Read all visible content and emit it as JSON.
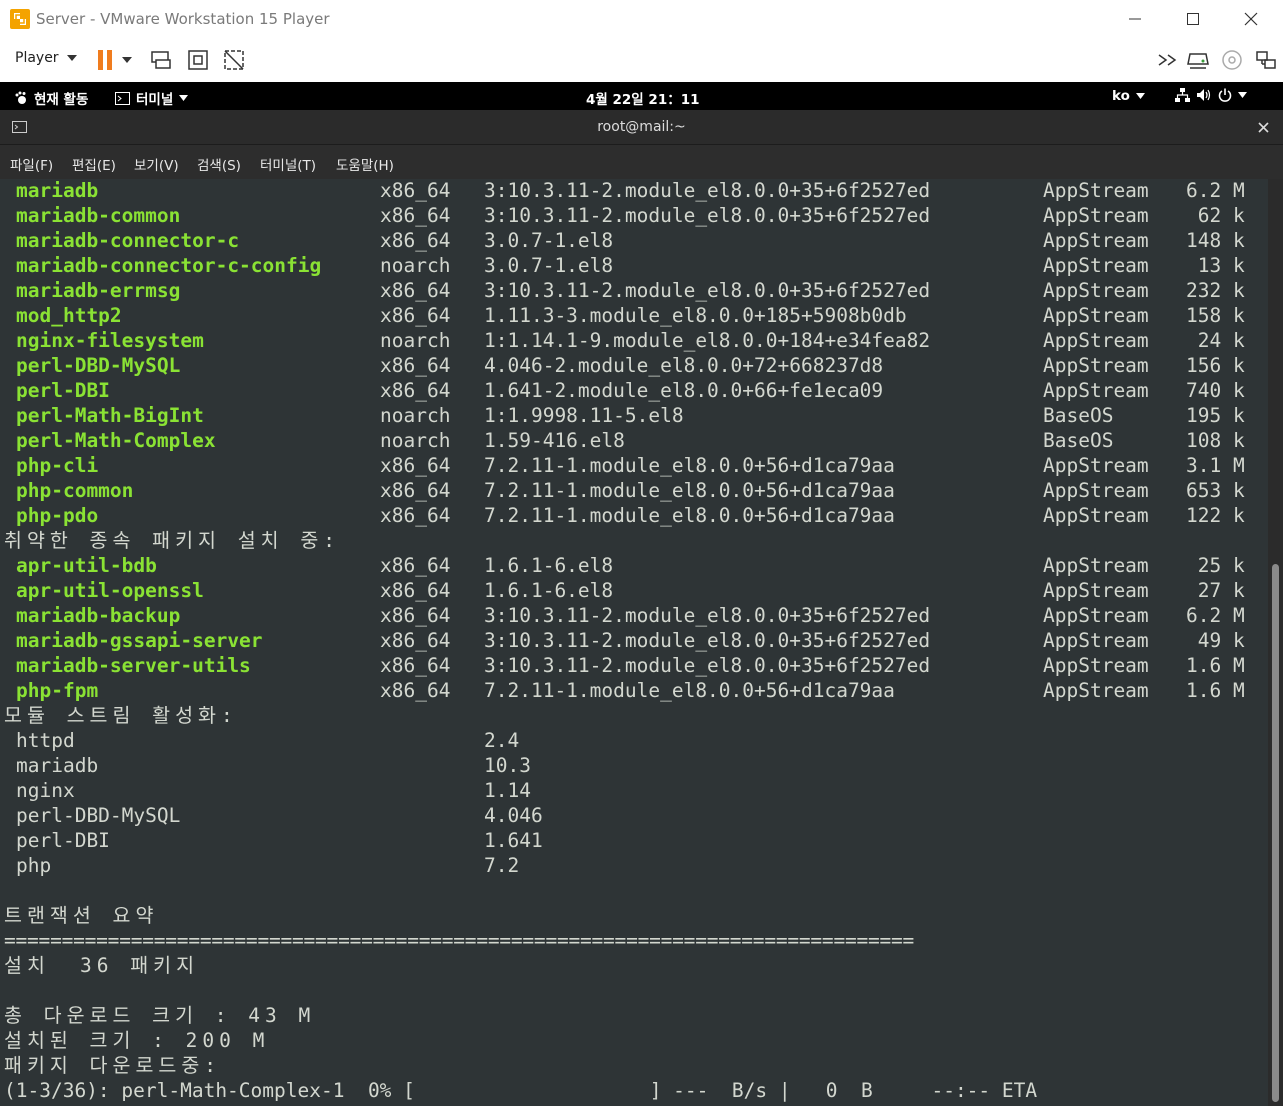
{
  "window": {
    "title": "Server - VMware Workstation 15 Player",
    "minimize_icon": "minimize-icon",
    "maximize_icon": "maximize-icon",
    "close_icon": "close-icon"
  },
  "toolbar": {
    "player_label": "Player"
  },
  "gnome_bar": {
    "activities": "현재 활동",
    "app_menu": "터미널",
    "clock": "4월 22일  21：11",
    "input_lang": "ko"
  },
  "terminal": {
    "title": "root@mail:~",
    "menu": [
      "파일(F)",
      "편집(E)",
      "보기(V)",
      "검색(S)",
      "터미널(T)",
      "도움말(H)"
    ],
    "packages": [
      {
        "name": "mariadb",
        "arch": "x86_64",
        "version": "3:10.3.11-2.module_el8.0.0+35+6f2527ed",
        "repo": "AppStream",
        "size": "6.2 M"
      },
      {
        "name": "mariadb-common",
        "arch": "x86_64",
        "version": "3:10.3.11-2.module_el8.0.0+35+6f2527ed",
        "repo": "AppStream",
        "size": " 62 k"
      },
      {
        "name": "mariadb-connector-c",
        "arch": "x86_64",
        "version": "3.0.7-1.el8",
        "repo": "AppStream",
        "size": "148 k"
      },
      {
        "name": "mariadb-connector-c-config",
        "arch": "noarch",
        "version": "3.0.7-1.el8",
        "repo": "AppStream",
        "size": " 13 k"
      },
      {
        "name": "mariadb-errmsg",
        "arch": "x86_64",
        "version": "3:10.3.11-2.module_el8.0.0+35+6f2527ed",
        "repo": "AppStream",
        "size": "232 k"
      },
      {
        "name": "mod_http2",
        "arch": "x86_64",
        "version": "1.11.3-3.module_el8.0.0+185+5908b0db",
        "repo": "AppStream",
        "size": "158 k"
      },
      {
        "name": "nginx-filesystem",
        "arch": "noarch",
        "version": "1:1.14.1-9.module_el8.0.0+184+e34fea82",
        "repo": "AppStream",
        "size": " 24 k"
      },
      {
        "name": "perl-DBD-MySQL",
        "arch": "x86_64",
        "version": "4.046-2.module_el8.0.0+72+668237d8",
        "repo": "AppStream",
        "size": "156 k"
      },
      {
        "name": "perl-DBI",
        "arch": "x86_64",
        "version": "1.641-2.module_el8.0.0+66+fe1eca09",
        "repo": "AppStream",
        "size": "740 k"
      },
      {
        "name": "perl-Math-BigInt",
        "arch": "noarch",
        "version": "1:1.9998.11-5.el8",
        "repo": "BaseOS",
        "size": "195 k"
      },
      {
        "name": "perl-Math-Complex",
        "arch": "noarch",
        "version": "1.59-416.el8",
        "repo": "BaseOS",
        "size": "108 k"
      },
      {
        "name": "php-cli",
        "arch": "x86_64",
        "version": "7.2.11-1.module_el8.0.0+56+d1ca79aa",
        "repo": "AppStream",
        "size": "3.1 M"
      },
      {
        "name": "php-common",
        "arch": "x86_64",
        "version": "7.2.11-1.module_el8.0.0+56+d1ca79aa",
        "repo": "AppStream",
        "size": "653 k"
      },
      {
        "name": "php-pdo",
        "arch": "x86_64",
        "version": "7.2.11-1.module_el8.0.0+56+d1ca79aa",
        "repo": "AppStream",
        "size": "122 k"
      }
    ],
    "weak_deps_header": "취약한 종속 패키지 설치 중:",
    "weak_deps": [
      {
        "name": "apr-util-bdb",
        "arch": "x86_64",
        "version": "1.6.1-6.el8",
        "repo": "AppStream",
        "size": " 25 k"
      },
      {
        "name": "apr-util-openssl",
        "arch": "x86_64",
        "version": "1.6.1-6.el8",
        "repo": "AppStream",
        "size": " 27 k"
      },
      {
        "name": "mariadb-backup",
        "arch": "x86_64",
        "version": "3:10.3.11-2.module_el8.0.0+35+6f2527ed",
        "repo": "AppStream",
        "size": "6.2 M"
      },
      {
        "name": "mariadb-gssapi-server",
        "arch": "x86_64",
        "version": "3:10.3.11-2.module_el8.0.0+35+6f2527ed",
        "repo": "AppStream",
        "size": " 49 k"
      },
      {
        "name": "mariadb-server-utils",
        "arch": "x86_64",
        "version": "3:10.3.11-2.module_el8.0.0+35+6f2527ed",
        "repo": "AppStream",
        "size": "1.6 M"
      },
      {
        "name": "php-fpm",
        "arch": "x86_64",
        "version": "7.2.11-1.module_el8.0.0+56+d1ca79aa",
        "repo": "AppStream",
        "size": "1.6 M"
      }
    ],
    "modules_header": "모듈 스트림 활성화:",
    "modules": [
      {
        "name": "httpd",
        "stream": "2.4"
      },
      {
        "name": "mariadb",
        "stream": "10.3"
      },
      {
        "name": "nginx",
        "stream": "1.14"
      },
      {
        "name": "perl-DBD-MySQL",
        "stream": "4.046"
      },
      {
        "name": "perl-DBI",
        "stream": "1.641"
      },
      {
        "name": "php",
        "stream": "7.2"
      }
    ],
    "summary_header": "트랜잭션 요약",
    "separator": "===============================================================================",
    "install_label": "설치",
    "install_count": "36 패키지",
    "download_size": "총 다운로드 크기 : 43 M",
    "installed_size": "설치된 크기 : 200 M",
    "downloading": "패키지 다운로드중:",
    "progress_line": "(1-3/36): perl-Math-Complex-1  0% [                    ] ---  B/s |   0  B     --:-- ETA"
  }
}
